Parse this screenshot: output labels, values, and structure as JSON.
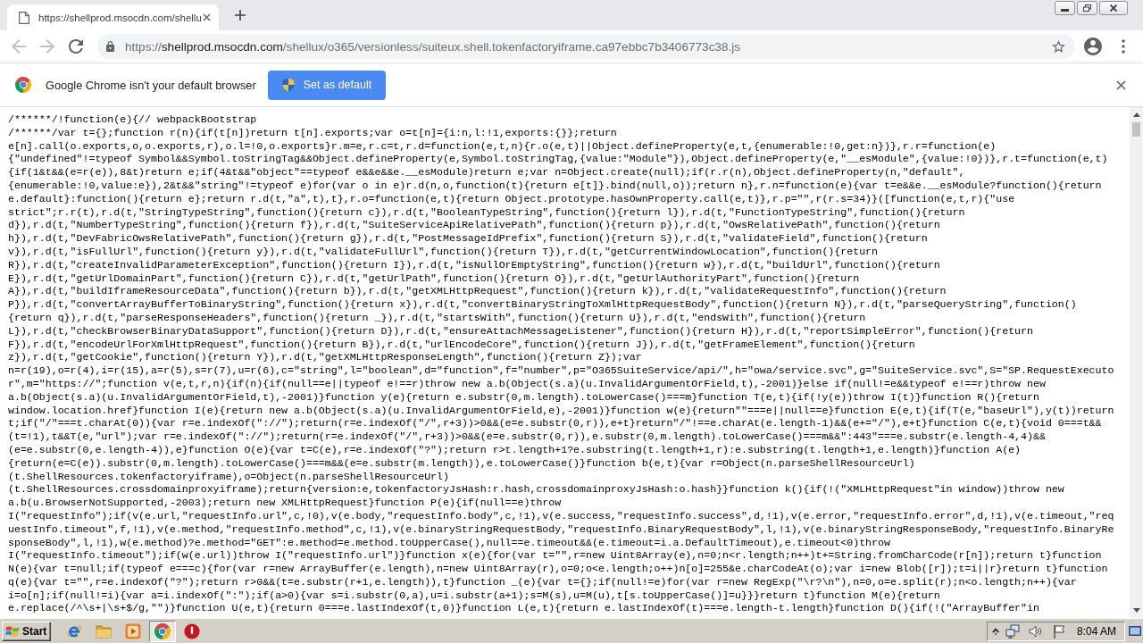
{
  "tabs": [
    {
      "title": "https://shellprod.msocdn.com/shellu",
      "selected": true
    }
  ],
  "toolbar": {
    "nav": [
      {
        "kind": "back",
        "disabled": true
      },
      {
        "kind": "forward",
        "disabled": true
      },
      {
        "kind": "reload",
        "disabled": false
      }
    ],
    "address": {
      "scheme": "https://",
      "host": "shellprod.msocdn.com",
      "path": "/shellux/o365/versionless/suiteux.shell.tokenfactoryiframe.ca97ebbc7b3406773c38.js"
    }
  },
  "infobar": {
    "message": "Google Chrome isn't your default browser",
    "button": "Set as default"
  },
  "source": {
    "lines": [
      "/******/!function(e){// webpackBootstrap",
      "/******/var t={};function r(n){if(t[n])return t[n].exports;var o=t[n]={i:n,l:!1,exports:{}};return",
      "e[n].call(o.exports,o,o.exports,r),o.l=!0,o.exports}r.m=e,r.c=t,r.d=function(e,t,n){r.o(e,t)||Object.defineProperty(e,t,{enumerable:!0,get:n})},r.r=function(e)",
      "{\"undefined\"!=typeof Symbol&&Symbol.toStringTag&&Object.defineProperty(e,Symbol.toStringTag,{value:\"Module\"}),Object.defineProperty(e,\"__esModule\",{value:!0})},r.t=function(e,t)",
      "{if(1&t&&(e=r(e)),8&t)return e;if(4&t&&\"object\"==typeof e&&e&&e.__esModule)return e;var n=Object.create(null);if(r.r(n),Object.defineProperty(n,\"default\",",
      "{enumerable:!0,value:e}),2&t&&\"string\"!=typeof e)for(var o in e)r.d(n,o,function(t){return e[t]}.bind(null,o));return n},r.n=function(e){var t=e&&e.__esModule?function(){return",
      "e.default}:function(){return e};return r.d(t,\"a\",t),t},r.o=function(e,t){return Object.prototype.hasOwnProperty.call(e,t)},r.p=\"\",r(r.s=34)}([function(e,t,r){\"use",
      "strict\";r.r(t),r.d(t,\"StringTypeString\",function(){return c}),r.d(t,\"BooleanTypeString\",function(){return l}),r.d(t,\"FunctionTypeString\",function(){return",
      "d}),r.d(t,\"NumberTypeString\",function(){return f}),r.d(t,\"SuiteServiceApiRelativePath\",function(){return p}),r.d(t,\"OwsRelativePath\",function(){return",
      "h}),r.d(t,\"DevFabricOwsRelativePath\",function(){return g}),r.d(t,\"PostMessageIdPrefix\",function(){return S}),r.d(t,\"validateField\",function(){return",
      "v}),r.d(t,\"isFullUrl\",function(){return y}),r.d(t,\"validateFullUrl\",function(){return T}),r.d(t,\"getCurrentWindowLocation\",function(){return",
      "R}),r.d(t,\"createInvalidParameterException\",function(){return I}),r.d(t,\"isNullOrEmptyString\",function(){return w}),r.d(t,\"buildUrl\",function(){return",
      "E}),r.d(t,\"getUrlDomainPart\",function(){return C}),r.d(t,\"getUrlPath\",function(){return O}),r.d(t,\"getUrlAuthorityPart\",function(){return",
      "A}),r.d(t,\"buildIframeResourceData\",function(){return b}),r.d(t,\"getXMLHttpRequest\",function(){return k}),r.d(t,\"validateRequestInfo\",function(){return",
      "P}),r.d(t,\"convertArrayBufferToBinaryString\",function(){return x}),r.d(t,\"convertBinaryStringToXmlHttpRequestBody\",function(){return N}),r.d(t,\"parseQueryString\",function()",
      "{return q}),r.d(t,\"parseResponseHeaders\",function(){return _}),r.d(t,\"startsWith\",function(){return U}),r.d(t,\"endsWith\",function(){return",
      "L}),r.d(t,\"checkBrowserBinaryDataSupport\",function(){return D}),r.d(t,\"ensureAttachMessageListener\",function(){return H}),r.d(t,\"reportSimpleError\",function(){return",
      "F}),r.d(t,\"encodeUrlForXmlHttpRequest\",function(){return B}),r.d(t,\"urlEncodeCore\",function(){return J}),r.d(t,\"getFrameElement\",function(){return",
      "z}),r.d(t,\"getCookie\",function(){return Y}),r.d(t,\"getXMLHttpResponseLength\",function(){return Z});var",
      "n=r(19),o=r(4),i=r(15),a=r(5),s=r(7),u=r(6),c=\"string\",l=\"boolean\",d=\"function\",f=\"number\",p=\"O365SuiteService/api/\",h=\"owa/service.svc\",g=\"SuiteService.svc\",S=\"SP.RequestExecuto",
      "r\",m=\"https://\";function v(e,t,r,n){if(n){if(null==e||typeof e!==r)throw new a.b(Object(s.a)(u.InvalidArgumentOrField,t),-2001)}else if(null!=e&&typeof e!==r)throw new",
      "a.b(Object(s.a)(u.InvalidArgumentOrField,t),-2001)}function y(e){return e.substr(0,m.length).toLowerCase()===m}function T(e,t){if(!y(e))throw I(t)}function R(){return",
      "window.location.href}function I(e){return new a.b(Object(s.a)(u.InvalidArgumentOrField,e),-2001)}function w(e){return\"\"===e||null==e}function E(e,t){if(T(e,\"baseUrl\"),y(t))return",
      "t;if(\"/\"===t.charAt(0)){var r=e.indexOf(\"://\");return(r=e.indexOf(\"/\",r+3))>0&&(e=e.substr(0,r)),e+t}return\"/\"!==e.charAt(e.length-1)&&(e+=\"/\"),e+t}function C(e,t){void 0===t&&",
      "(t=!1),t&&T(e,\"url\");var r=e.indexOf(\"://\");return(r=e.indexOf(\"/\",r+3))>0&&(e=e.substr(0,r)),e.substr(0,m.length).toLowerCase()===m&&\":443\"===e.substr(e.length-4,4)&&",
      "(e=e.substr(0,e.length-4)),e}function O(e){var t=C(e),r=e.indexOf(\"?\");return r>t.length+1?e.substring(t.length+1,r):e.substring(t.length+1,e.length)}function A(e)",
      "{return(e=C(e)).substr(0,m.length).toLowerCase()===m&&(e=e.substr(m.length)),e.toLowerCase()}function b(e,t){var r=Object(n.parseShellResourceUrl)",
      "(t.ShellResources.tokenfactoryiframe),o=Object(n.parseShellResourceUrl)",
      "(t.ShellResources.crossdomainproxyiframe);return{version:e,tokenfactoryJsHash:r.hash,crossdomainproxyJsHash:o.hash}}function k(){if(!(\"XMLHttpRequest\"in window))throw new",
      "a.b(u.BrowserNotSupported,-2003);return new XMLHttpRequest}function P(e){if(null==e)throw",
      "I(\"requestInfo\");if(v(e.url,\"requestInfo.url\",c,!0),v(e.body,\"requestInfo.body\",c,!1),v(e.success,\"requestInfo.success\",d,!1),v(e.error,\"requestInfo.error\",d,!1),v(e.timeout,\"req",
      "uestInfo.timeout\",f,!1),v(e.method,\"requestInfo.method\",c,!1),v(e.binaryStringRequestBody,\"requestInfo.BinaryRequestBody\",l,!1),v(e.binaryStringResponseBody,\"requestInfo.BinaryRe",
      "sponseBody\",l,!1),w(e.method)?e.method=\"GET\":e.method=e.method.toUpperCase(),null==e.timeout&&(e.timeout=i.a.DefaultTimeout),e.timeout<0)throw",
      "I(\"requestInfo.timeout\");if(w(e.url))throw I(\"requestInfo.url\")}function x(e){for(var t=\"\",r=new Uint8Array(e),n=0;n<r.length;n++)t+=String.fromCharCode(r[n]);return t}function",
      "N(e){var t=null;if(typeof e===c){for(var r=new ArrayBuffer(e.length),n=new Uint8Array(r),o=0;o<e.length;o++)n[o]=255&e.charCodeAt(o);var i=new Blob([r]);t=i||r}return t}function",
      "q(e){var t=\"\",r=e.indexOf(\"?\");return r>0&&(t=e.substr(r+1,e.length)),t}function _(e){var t={};if(null!=e)for(var r=new RegExp(\"\\r?\\n\"),n=0,o=e.split(r);n<o.length;n++){var",
      "i=o[n];if(null!=i){var a=i.indexOf(\":\");if(a>0){var s=i.substr(0,a),u=i.substr(a+1);s=M(s),u=M(u),t[s.toUpperCase()]=u}}}return t}function M(e){return",
      "e.replace(/^\\s+|\\s+$/g,\"\")}function U(e,t){return 0===e.lastIndexOf(t,0)}function L(e,t){return e.lastIndexOf(t)===e.length-t.length}function D(){if(!(\"ArrayBuffer\"in"
    ]
  },
  "taskbar": {
    "start": "Start",
    "apps": [
      {
        "kind": "ie",
        "selected": false
      },
      {
        "kind": "folder",
        "selected": false
      },
      {
        "kind": "media",
        "selected": false
      },
      {
        "kind": "chrome",
        "selected": true
      },
      {
        "kind": "alert",
        "selected": false
      }
    ],
    "clock": "8:04 AM"
  }
}
